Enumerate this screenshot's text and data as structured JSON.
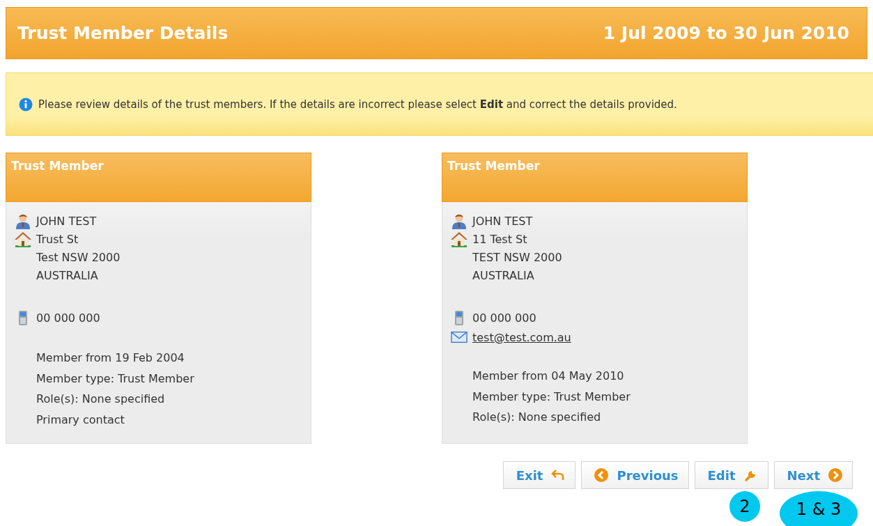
{
  "header": {
    "title": "Trust Member Details",
    "period": "1 Jul 2009 to 30 Jun 2010"
  },
  "notice": "Please review details of the trust members. If the details are incorrect please select **Edit** and correct the details provided.",
  "members": [
    {
      "heading": "Trust Member",
      "name": "JOHN TEST",
      "address": [
        "Trust St",
        "Test NSW 2000",
        "AUSTRALIA"
      ],
      "phone": "00 000 000",
      "details": [
        "Member from 19 Feb 2004",
        "Member type: Trust Member",
        "Role(s): None specified",
        "Primary contact"
      ]
    },
    {
      "heading": "Trust Member",
      "name": "JOHN TEST",
      "address": [
        "11 Test St",
        "TEST NSW 2000",
        "AUSTRALIA"
      ],
      "phone": "00 000 000",
      "email": "test@test.com.au",
      "details": [
        "Member from 04 May 2010",
        "Member type: Trust Member",
        "Role(s): None specified"
      ]
    }
  ],
  "buttons": [
    {
      "label": "Exit",
      "kind": "exit"
    },
    {
      "label": "Previous",
      "kind": "previous"
    },
    {
      "label": "Edit",
      "kind": "edit"
    },
    {
      "label": "Next",
      "kind": "next"
    }
  ],
  "callouts": [
    {
      "label": "2",
      "kind": "circle"
    },
    {
      "label": "1 & 3",
      "kind": "ellipse"
    }
  ]
}
